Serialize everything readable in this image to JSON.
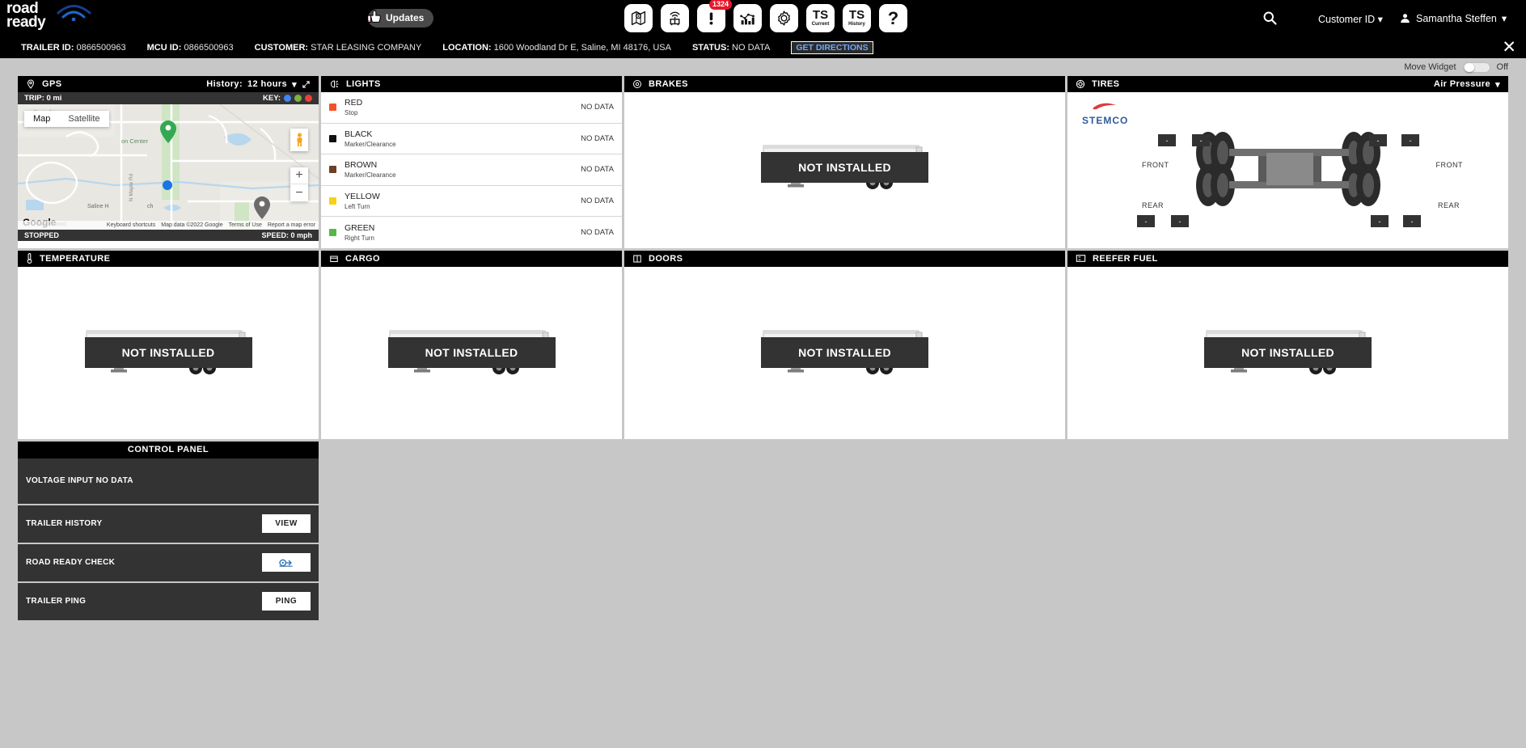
{
  "header": {
    "logo_line1": "road",
    "logo_line2": "ready",
    "updates_label": "Updates",
    "nav_icons": [
      {
        "name": "map-icon",
        "label": ""
      },
      {
        "name": "trailer-signal-icon",
        "label": ""
      },
      {
        "name": "alerts-icon",
        "label": "",
        "badge": "1324"
      },
      {
        "name": "reports-chart-icon",
        "label": ""
      },
      {
        "name": "settings-gear-icon",
        "label": ""
      },
      {
        "name": "ts-current-icon",
        "label": "TS",
        "sub": "Current"
      },
      {
        "name": "ts-history-icon",
        "label": "TS",
        "sub": "History"
      },
      {
        "name": "help-icon",
        "label": "?"
      }
    ],
    "customer_id_label": "Customer ID",
    "user_name": "Samantha Steffen",
    "caret": "▾"
  },
  "infobar": {
    "trailer_id_label": "TRAILER ID:",
    "trailer_id_value": "0866500963",
    "mcu_id_label": "MCU ID:",
    "mcu_id_value": "0866500963",
    "customer_label": "CUSTOMER:",
    "customer_value": "STAR LEASING COMPANY",
    "location_label": "LOCATION:",
    "location_value": "1600 Woodland Dr E, Saline, MI 48176, USA",
    "status_label": "STATUS:",
    "status_value": "NO DATA",
    "get_directions": "GET DIRECTIONS",
    "close": "✕"
  },
  "move_widget": {
    "label": "Move Widget",
    "state": "Off"
  },
  "gps": {
    "title": "GPS",
    "history_label": "History:",
    "history_value": "12 hours",
    "trip_label": "TRIP: 0 mi",
    "key_label": "KEY:",
    "key_colors": [
      "#4285f4",
      "#7cb342",
      "#ea4335"
    ],
    "map_tab": "Map",
    "satellite_tab": "Satellite",
    "zoom_in": "+",
    "zoom_out": "−",
    "attribution_keyboard": "Keyboard shortcuts",
    "attribution_data": "Map data ©2022 Google",
    "attribution_terms": "Terms of Use",
    "attribution_report": "Report a map error",
    "google_mark": "Google",
    "status": "STOPPED",
    "speed": "SPEED: 0 mph",
    "map_labels": [
      "Textile Rd",
      "on Center",
      "N Maple Rd",
      "Saline H",
      "ch",
      "Maplewood"
    ]
  },
  "lights": {
    "title": "LIGHTS",
    "rows": [
      {
        "name": "RED",
        "sub": "Stop",
        "color": "#f0532a",
        "value": "NO DATA"
      },
      {
        "name": "BLACK",
        "sub": "Marker/Clearance",
        "color": "#111111",
        "value": "NO DATA"
      },
      {
        "name": "BROWN",
        "sub": "Marker/Clearance",
        "color": "#6b4024",
        "value": "NO DATA"
      },
      {
        "name": "YELLOW",
        "sub": "Left Turn",
        "color": "#f5d211",
        "value": "NO DATA"
      },
      {
        "name": "GREEN",
        "sub": "Right Turn",
        "color": "#57b846",
        "value": "NO DATA"
      }
    ]
  },
  "brakes": {
    "title": "BRAKES",
    "status": "NOT INSTALLED"
  },
  "tires": {
    "title": "TIRES",
    "mode": "Air Pressure",
    "brand": "STEMCO",
    "labels": {
      "front_left": "FRONT",
      "front_right": "FRONT",
      "rear_left": "REAR",
      "rear_right": "REAR"
    },
    "readings": [
      "-",
      "-",
      "-",
      "-",
      "-",
      "-",
      "-",
      "-"
    ]
  },
  "temperature": {
    "title": "TEMPERATURE",
    "status": "NOT INSTALLED"
  },
  "cargo": {
    "title": "CARGO",
    "status": "NOT INSTALLED"
  },
  "doors": {
    "title": "DOORS",
    "status": "NOT INSTALLED"
  },
  "reefer_fuel": {
    "title": "REEFER FUEL",
    "status": "NOT INSTALLED"
  },
  "control_panel": {
    "title": "CONTROL PANEL",
    "voltage_label": "VOLTAGE INPUT NO DATA",
    "rows": [
      {
        "label": "TRAILER HISTORY",
        "button": "VIEW",
        "name": "trailer-history"
      },
      {
        "label": "ROAD READY CHECK",
        "button": "",
        "name": "road-ready-check"
      },
      {
        "label": "TRAILER PING",
        "button": "PING",
        "name": "trailer-ping"
      }
    ]
  }
}
